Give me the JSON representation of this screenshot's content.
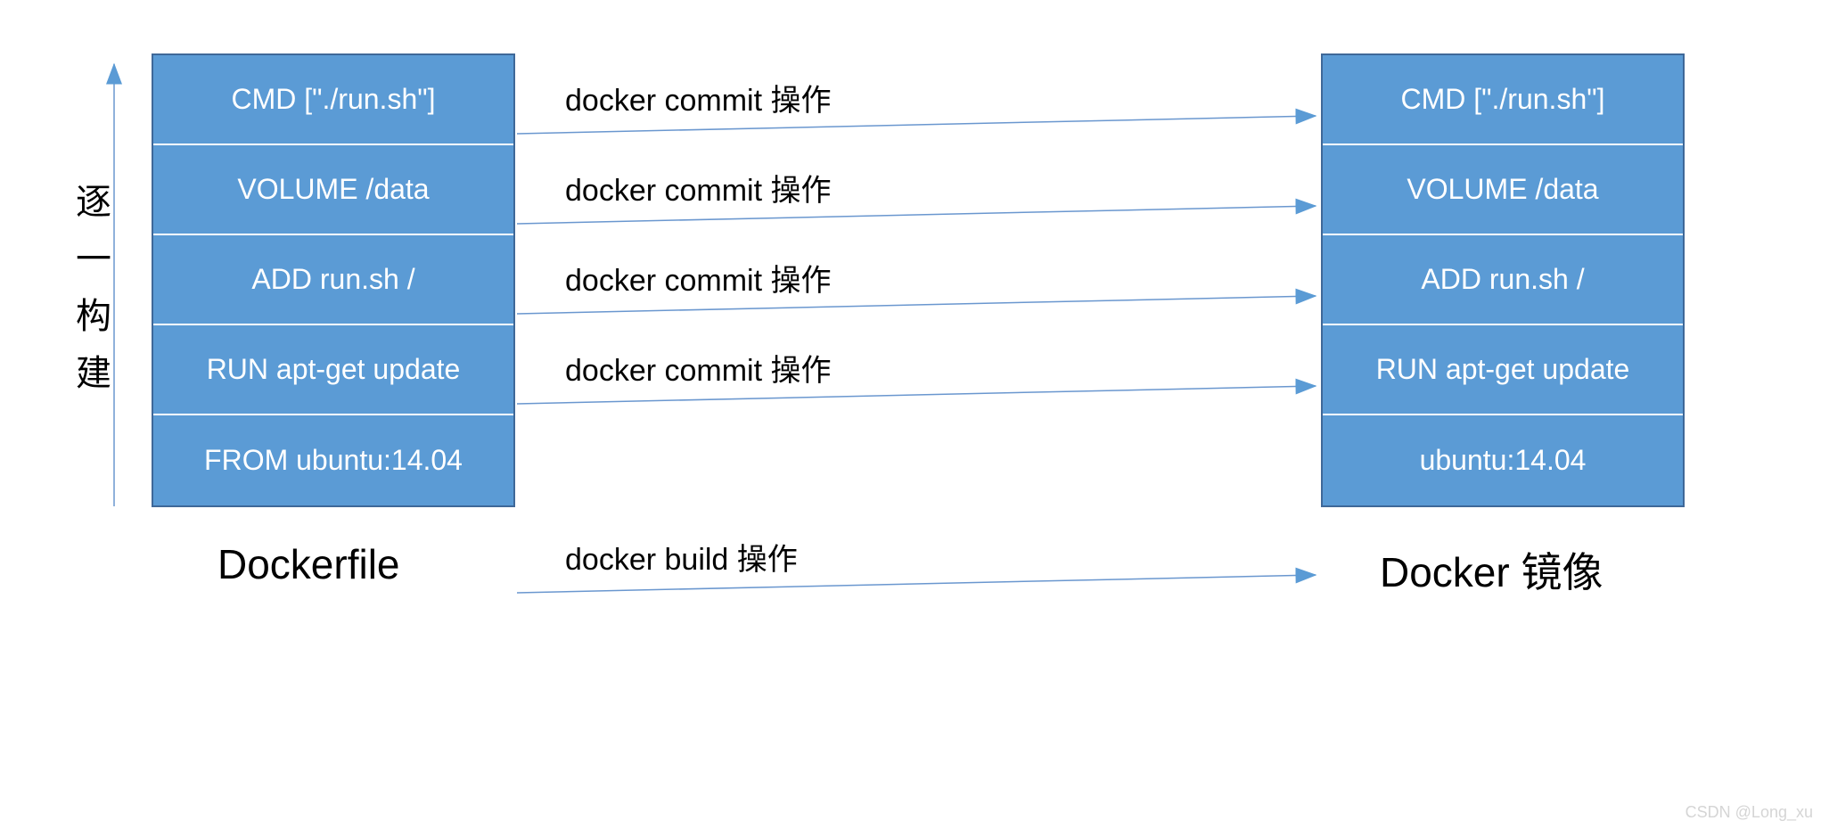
{
  "left": {
    "title": "Dockerfile",
    "layers": [
      "CMD [\"./run.sh\"]",
      "VOLUME /data",
      "ADD run.sh  /",
      "RUN apt-get update",
      "FROM ubuntu:14.04"
    ]
  },
  "right": {
    "title": "Docker 镜像",
    "layers": [
      "CMD [\"./run.sh\"]",
      "VOLUME /data",
      "ADD run.sh  /",
      "RUN apt-get update",
      "ubuntu:14.04"
    ]
  },
  "arrows": {
    "commit": [
      "docker commit 操作",
      "docker commit 操作",
      "docker commit 操作",
      "docker commit 操作"
    ],
    "build": "docker build 操作"
  },
  "sidenote": "逐一构建",
  "watermark": "CSDN @Long_xu"
}
